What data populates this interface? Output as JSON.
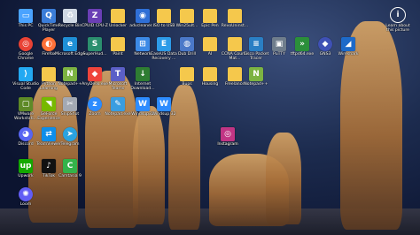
{
  "desktop": {
    "icons": [
      {
        "label": "This PC",
        "icon": "pc-icon",
        "color": "#4aa3ff",
        "glyph": "▭"
      },
      {
        "label": "QuickTime Player",
        "icon": "quicktime-icon",
        "color": "#3b7dd8",
        "glyph": "Q"
      },
      {
        "label": "Recycle Bin",
        "icon": "recycle-bin-icon",
        "color": "#cfd8e3",
        "glyph": "♻"
      },
      {
        "label": "CPUID CPU-Z",
        "icon": "cpu-z-icon",
        "color": "#6a3fb5",
        "glyph": "Z"
      },
      {
        "label": "Unlocker",
        "icon": "folder-icon",
        "color": "#f5c84c",
        "glyph": ""
      },
      {
        "label": "advcleaner...",
        "icon": "advcleaner-icon",
        "color": "#2f6fd6",
        "glyph": "◉"
      },
      {
        "label": "ISO to USB",
        "icon": "folder-icon",
        "color": "#f5c84c",
        "glyph": ""
      },
      {
        "label": "Win25ult...",
        "icon": "folder-icon",
        "color": "#f5c84c",
        "glyph": ""
      },
      {
        "label": "Epic Pen",
        "icon": "folder-icon",
        "color": "#f5c84c",
        "glyph": ""
      },
      {
        "label": "RevoUninst...",
        "icon": "folder-icon",
        "color": "#f5c84c",
        "glyph": ""
      },
      {
        "label": "Google Chrome",
        "icon": "chrome-icon",
        "color": "#e94235",
        "glyph": "◎"
      },
      {
        "label": "Firefox",
        "icon": "firefox-icon",
        "color": "#ff7139",
        "glyph": "◐"
      },
      {
        "label": "Microsoft Edge",
        "icon": "edge-icon",
        "color": "#1f8fd6",
        "glyph": "e"
      },
      {
        "label": "SuperHud...",
        "icon": "superhud-icon",
        "color": "#2b8f6e",
        "glyph": "S"
      },
      {
        "label": "Paint",
        "icon": "folder-icon",
        "color": "#f5c84c",
        "glyph": ""
      },
      {
        "label": "Network",
        "icon": "network-icon",
        "color": "#3c8ae6",
        "glyph": "⊞"
      },
      {
        "label": "EaseUS Data Recovery ...",
        "icon": "easeus-icon",
        "color": "#2d9be8",
        "glyph": "E"
      },
      {
        "label": "Dub Drill",
        "icon": "dubdrill-icon",
        "color": "#4a78c8",
        "glyph": "◍"
      },
      {
        "label": "AI",
        "icon": "folder-icon",
        "color": "#f5c84c",
        "glyph": ""
      },
      {
        "label": "CCNA Course Mat...",
        "icon": "folder-icon",
        "color": "#f5c84c",
        "glyph": ""
      },
      {
        "label": "Cisco Packet Tracer",
        "icon": "cisco-icon",
        "color": "#2a7fc4",
        "glyph": "≡"
      },
      {
        "label": "PuTTY",
        "icon": "putty-icon",
        "color": "#6f7d8c",
        "glyph": "▣"
      },
      {
        "label": "tftpd64.exe",
        "icon": "tftp-icon",
        "color": "#2b8f3a",
        "glyph": "»"
      },
      {
        "label": "GNS3",
        "icon": "gns3-icon",
        "color": "#3f51b5",
        "glyph": "◆"
      },
      {
        "label": "Wireshark",
        "icon": "wireshark-icon",
        "color": "#1d6ac9",
        "glyph": "◢"
      },
      {
        "label": "Visual Studio Code",
        "icon": "vscode-icon",
        "color": "#23a9f2",
        "glyph": "⟩"
      },
      {
        "label": "Python Learning",
        "icon": "folder-icon",
        "color": "#f5c84c",
        "glyph": ""
      },
      {
        "label": "Notepad++",
        "icon": "notepadpp-icon",
        "color": "#7cb342",
        "glyph": "N"
      },
      {
        "label": "AnyDesk.exe",
        "icon": "anydesk-icon",
        "color": "#ef443b",
        "glyph": "◆"
      },
      {
        "label": "Microsoft Teams",
        "icon": "teams-icon",
        "color": "#5b5fc7",
        "glyph": "T"
      },
      {
        "label": "Internet Download...",
        "icon": "idm-icon",
        "color": "#2e7d32",
        "glyph": "↓"
      },
      {
        "label": "Bups",
        "icon": "folder-icon",
        "color": "#f5c84c",
        "glyph": ""
      },
      {
        "label": "Housing",
        "icon": "folder-icon",
        "color": "#f5c84c",
        "glyph": ""
      },
      {
        "label": "Freelance",
        "icon": "folder-icon",
        "color": "#f5c84c",
        "glyph": ""
      },
      {
        "label": "Notepad++",
        "icon": "notepadpp-icon",
        "color": "#7cb342",
        "glyph": "N"
      },
      {
        "label": "VMware Workstati...",
        "icon": "vmware-icon",
        "color": "#5e8a27",
        "glyph": "▢"
      },
      {
        "label": "GeForce Experience",
        "icon": "geforce-icon",
        "color": "#76b900",
        "glyph": "◥"
      },
      {
        "label": "SnipShot",
        "icon": "snipshot-icon",
        "color": "#a3a9b3",
        "glyph": "✂"
      },
      {
        "label": "Zoom",
        "icon": "zoom-icon",
        "color": "#2d8cff",
        "glyph": "z"
      },
      {
        "label": "Notepad.exe",
        "icon": "notepad-icon",
        "color": "#3a9de0",
        "glyph": "✎"
      },
      {
        "label": "Windsup32",
        "icon": "windsup-icon",
        "color": "#2d8cff",
        "glyph": "W"
      },
      {
        "label": "Windsup 32",
        "icon": "windsup-icon",
        "color": "#2d8cff",
        "glyph": "W"
      },
      {
        "label": "Discord",
        "icon": "discord-icon",
        "color": "#5865f2",
        "glyph": "◕"
      },
      {
        "label": "TeamViewer",
        "icon": "teamviewer-icon",
        "color": "#0e8ee9",
        "glyph": "⇄"
      },
      {
        "label": "Telegram",
        "icon": "telegram-icon",
        "color": "#2aa3e0",
        "glyph": "➤"
      },
      {
        "label": "Instagram",
        "icon": "instagram-icon",
        "color": "#c13584",
        "glyph": "◎"
      },
      {
        "label": "Upwork",
        "icon": "upwork-icon",
        "color": "#14a800",
        "glyph": "up"
      },
      {
        "label": "TikTok",
        "icon": "tiktok-icon",
        "color": "#111111",
        "glyph": "♪"
      },
      {
        "label": "Camtasia 9",
        "icon": "camtasia-icon",
        "color": "#34b34a",
        "glyph": "C"
      },
      {
        "label": "Loom",
        "icon": "loom-icon",
        "color": "#625df5",
        "glyph": "✺"
      },
      {
        "label": "Instagram",
        "icon": "instagram-icon",
        "color": "#c13584",
        "glyph": "◎"
      }
    ],
    "start": {
      "label": "Learn about this picture",
      "icon": "learn-about-icon",
      "color": "#ffffff"
    }
  }
}
